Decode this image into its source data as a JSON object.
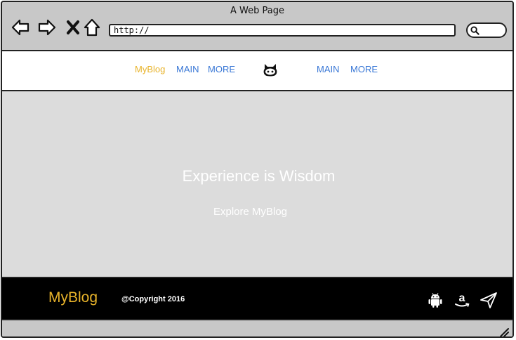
{
  "window": {
    "title": "A Web Page"
  },
  "address_bar": {
    "url": "http://"
  },
  "toolbar": {
    "icons": [
      "back-arrow-icon",
      "forward-arrow-icon",
      "close-x-icon",
      "home-icon",
      "search-icon"
    ]
  },
  "nav": {
    "brand": "MyBlog",
    "left_links": [
      "MAIN",
      "MORE"
    ],
    "right_links": [
      "MAIN",
      "MORE"
    ],
    "center_icon": "github-octocat-icon"
  },
  "hero": {
    "title": "Experience is Wisdom",
    "cta": "Explore MyBlog"
  },
  "footer": {
    "brand": "MyBlog",
    "copyright": "@Copyright 2016",
    "icons": [
      "android-icon",
      "amazon-icon",
      "send-plane-icon"
    ]
  },
  "colors": {
    "brand": "#e8b32a",
    "link": "#3a78d6",
    "hero_bg": "#dcdcdc",
    "footer_bg": "#000000",
    "chrome_bg": "#c8c8c8"
  }
}
